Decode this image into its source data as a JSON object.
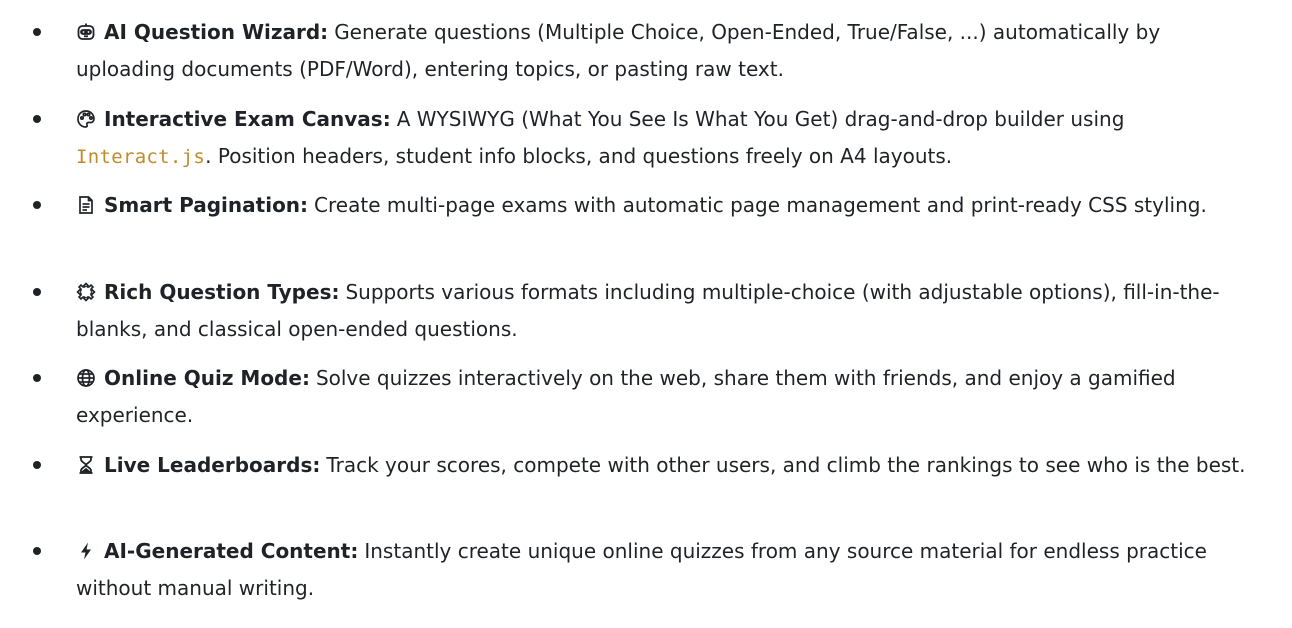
{
  "features": [
    {
      "icon": "robot-icon",
      "title": "AI Question Wizard:",
      "text": "Generate questions (Multiple Choice, Open-Ended, True/False, ...) automatically by uploading documents (PDF/Word), entering topics, or pasting raw text."
    },
    {
      "icon": "palette-icon",
      "title": "Interactive Exam Canvas:",
      "text_before": "A WYSIWYG (What You See Is What You Get) drag-and-drop builder using ",
      "code": "Interact.js",
      "text_after": ". Position headers, student info blocks, and questions freely on A4 layouts."
    },
    {
      "icon": "document-icon",
      "title": "Smart Pagination:",
      "text": "Create multi-page exams with automatic page management and print-ready CSS styling."
    },
    {
      "icon": "puzzle-icon",
      "title": "Rich Question Types:",
      "text": "Supports various formats including multiple-choice (with adjustable options), fill-in-the-blanks, and classical open-ended questions."
    },
    {
      "icon": "globe-icon",
      "title": "Online Quiz Mode:",
      "text": "Solve quizzes interactively on the web, share them with friends, and enjoy a gamified experience."
    },
    {
      "icon": "hourglass-icon",
      "title": "Live Leaderboards:",
      "text": "Track your scores, compete with other users, and climb the rankings to see who is the best."
    },
    {
      "icon": "lightning-icon",
      "title": "AI-Generated Content:",
      "text": "Instantly create unique online quizzes from any source material for endless practice without manual writing."
    }
  ]
}
